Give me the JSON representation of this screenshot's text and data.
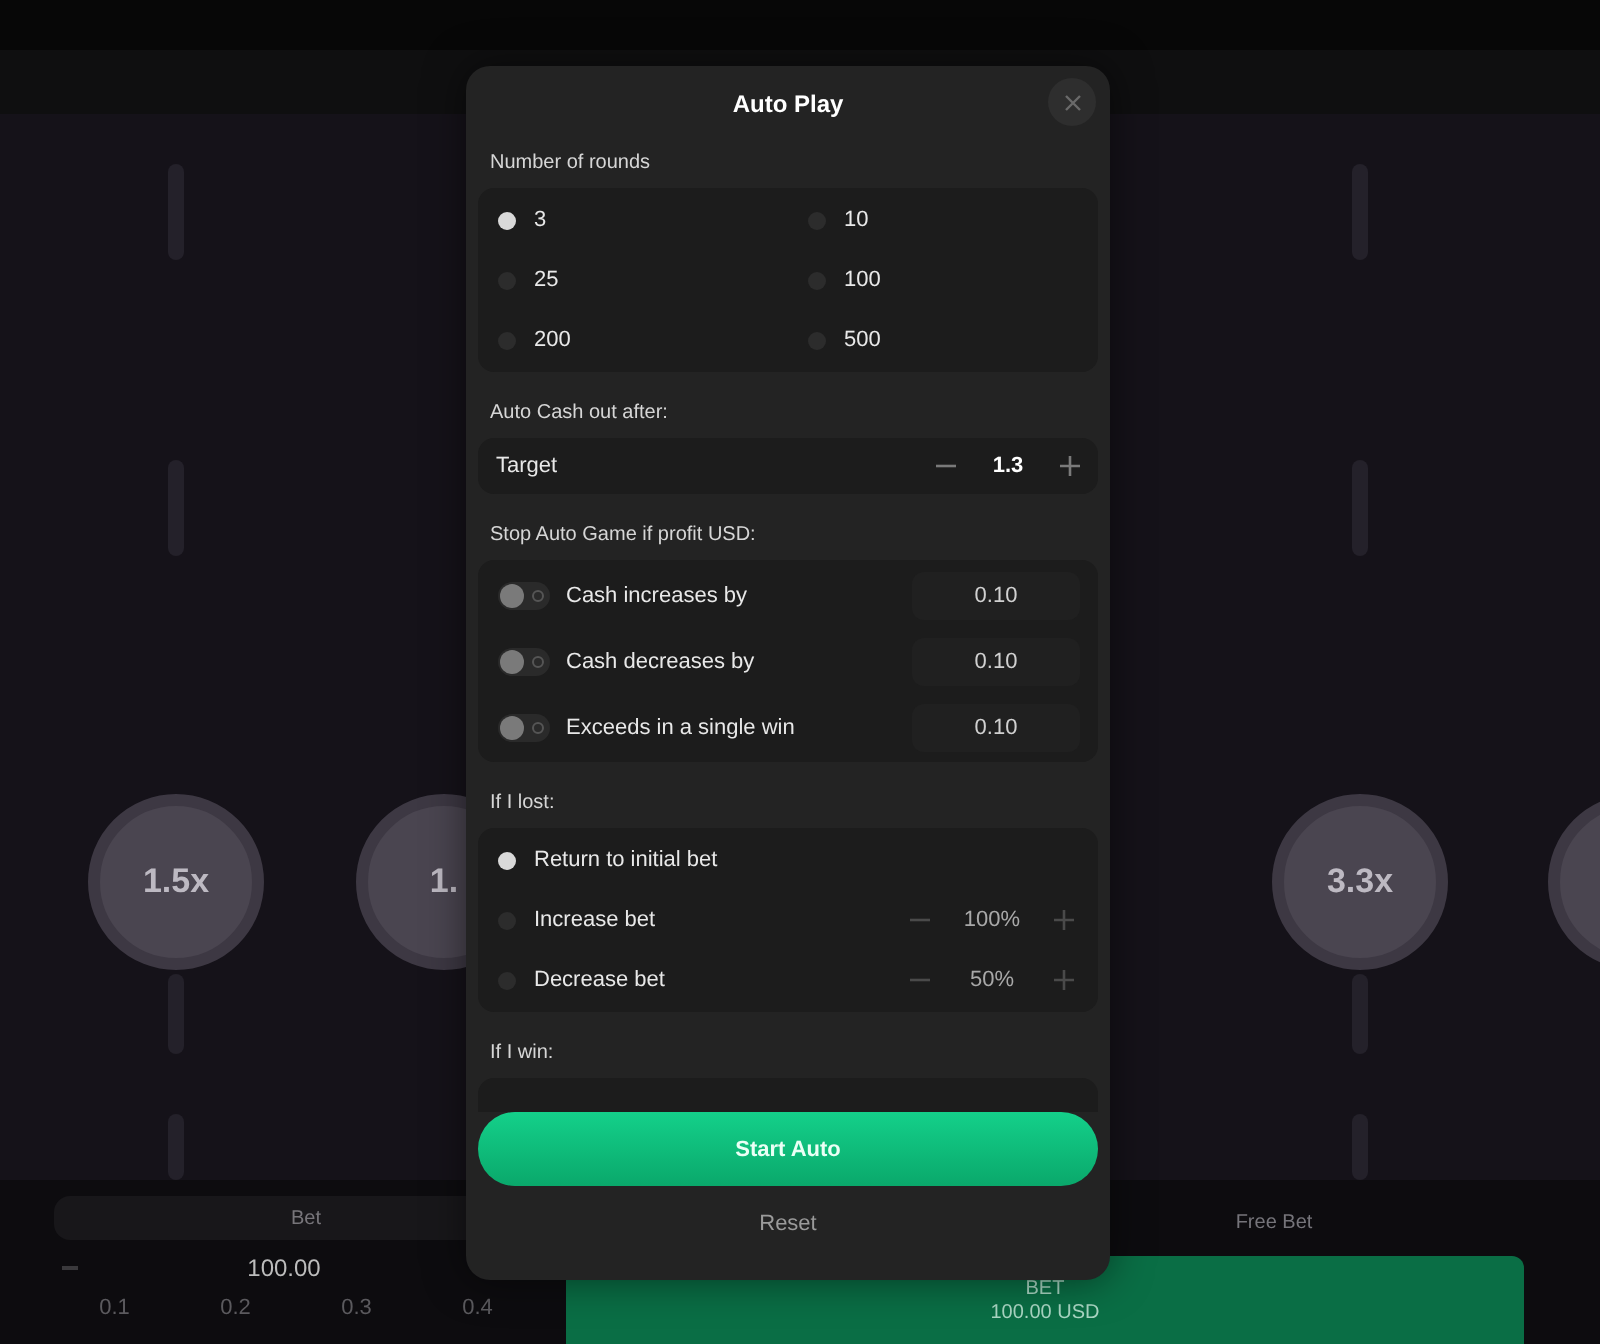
{
  "game": {
    "chips": [
      {
        "label": "1.5x"
      },
      {
        "label": "1."
      },
      {
        "label": "3.3x"
      }
    ]
  },
  "bet_panel": {
    "tab": "Bet",
    "amount": "100.00",
    "quick_amounts": [
      "0.1",
      "0.2",
      "0.3",
      "0.4"
    ]
  },
  "free_bet_tab": "Free Bet",
  "bet_button": {
    "label": "BET",
    "amount": "100.00 USD"
  },
  "modal": {
    "title": "Auto Play",
    "rounds": {
      "label": "Number of rounds",
      "options": [
        {
          "value": "3",
          "selected": true
        },
        {
          "value": "10",
          "selected": false
        },
        {
          "value": "25",
          "selected": false
        },
        {
          "value": "100",
          "selected": false
        },
        {
          "value": "200",
          "selected": false
        },
        {
          "value": "500",
          "selected": false
        }
      ]
    },
    "cash_out": {
      "label": "Auto Cash out after:",
      "field": "Target",
      "value": "1.3"
    },
    "stop": {
      "label": "Stop Auto Game if profit USD:",
      "rows": [
        {
          "label": "Cash increases by",
          "on": false,
          "value": "0.10"
        },
        {
          "label": "Cash decreases by",
          "on": false,
          "value": "0.10"
        },
        {
          "label": "Exceeds in a single win",
          "on": false,
          "value": "0.10"
        }
      ]
    },
    "lost": {
      "label": "If I lost:",
      "options": [
        {
          "label": "Return to initial bet",
          "selected": true
        },
        {
          "label": "Increase bet",
          "selected": false,
          "value": "100%"
        },
        {
          "label": "Decrease bet",
          "selected": false,
          "value": "50%"
        }
      ]
    },
    "win": {
      "label": "If I win:"
    },
    "start_button": "Start Auto",
    "reset_button": "Reset"
  }
}
